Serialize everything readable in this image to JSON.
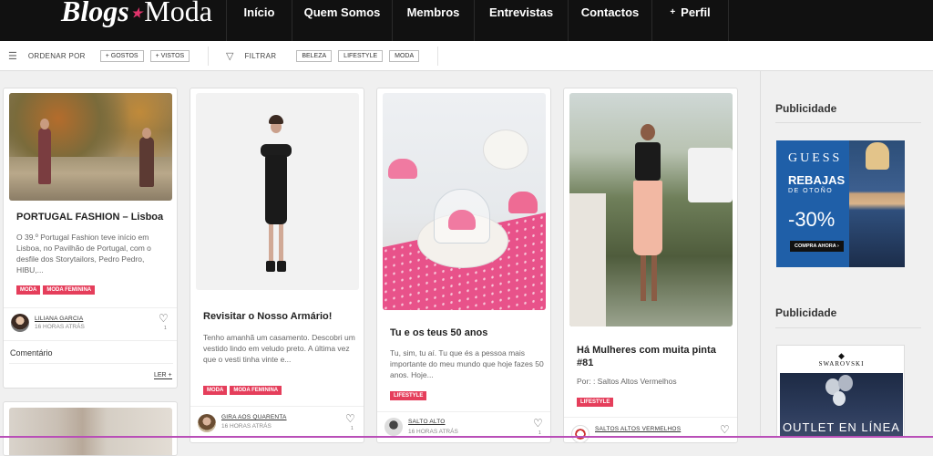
{
  "brand": {
    "part1": "Blogs",
    "star": "★",
    "part2": "Moda"
  },
  "nav": {
    "items": [
      "Início",
      "Quem Somos",
      "Membros",
      "Entrevistas",
      "Contactos"
    ],
    "profile_plus": "+",
    "profile": "Perfil"
  },
  "filterbar": {
    "sort_label": "ORDENAR POR",
    "sort_chips": [
      "+ GOSTOS",
      "+ VISTOS"
    ],
    "filter_label": "FILTRAR",
    "filter_chips": [
      "BELEZA",
      "LIFESTYLE",
      "MODA"
    ]
  },
  "cards": [
    {
      "title": "PORTUGAL FASHION – Lisboa",
      "desc": "O 39.º Portugal Fashion teve início em Lisboa, no Pavilhão de Portugal, com o desfile dos Storytailors, Pedro Pedro, HIBU,...",
      "tags": [
        "MODA",
        "MODA FEMININA"
      ],
      "author": "LILIANA GARCIA",
      "time": "16 HORAS ATRÁS",
      "likes": "1",
      "comment": "Comentário",
      "read_more": "LER +"
    },
    {
      "title": "Revisitar o Nosso Armário!",
      "desc": "Tenho amanhã um casamento. Descobri um vestido lindo em veludo preto. A última vez que o vesti tinha vinte e...",
      "tags": [
        "MODA",
        "MODA FEMININA"
      ],
      "author": "GIRA AOS QUARENTA",
      "time": "16 HORAS ATRÁS",
      "likes": "1"
    },
    {
      "title": "Tu e os teus 50 anos",
      "desc": "Tu, sim, tu aí. Tu que és a pessoa mais importante do meu mundo que hoje fazes 50 anos. Hoje...",
      "tags": [
        "LIFESTYLE"
      ],
      "author": "SALTO ALTO",
      "time": "16 HORAS ATRÁS",
      "likes": "1"
    },
    {
      "title": "Há Mulheres com muita pinta #81",
      "desc": "Por: : Saltos Altos Vermelhos",
      "tags": [
        "LIFESTYLE"
      ],
      "author": "SALTOS ALTOS VERMELHOS",
      "time": "",
      "likes": ""
    }
  ],
  "sidebar": {
    "ad1_title": "Publicidade",
    "ad1": {
      "brand": "GUESS",
      "line1": "REBAJAS",
      "line2": "DE OTOÑO",
      "discount": "-30%",
      "cta": "COMPRA AHORA ›"
    },
    "ad2_title": "Publicidade",
    "ad2": {
      "brand": "SWAROVSKI",
      "headline": "OUTLET EN LÍNEA"
    }
  },
  "colors": {
    "accent": "#e53e5b",
    "topbar": "#111111",
    "guess_blue": "#1f5fa8"
  }
}
